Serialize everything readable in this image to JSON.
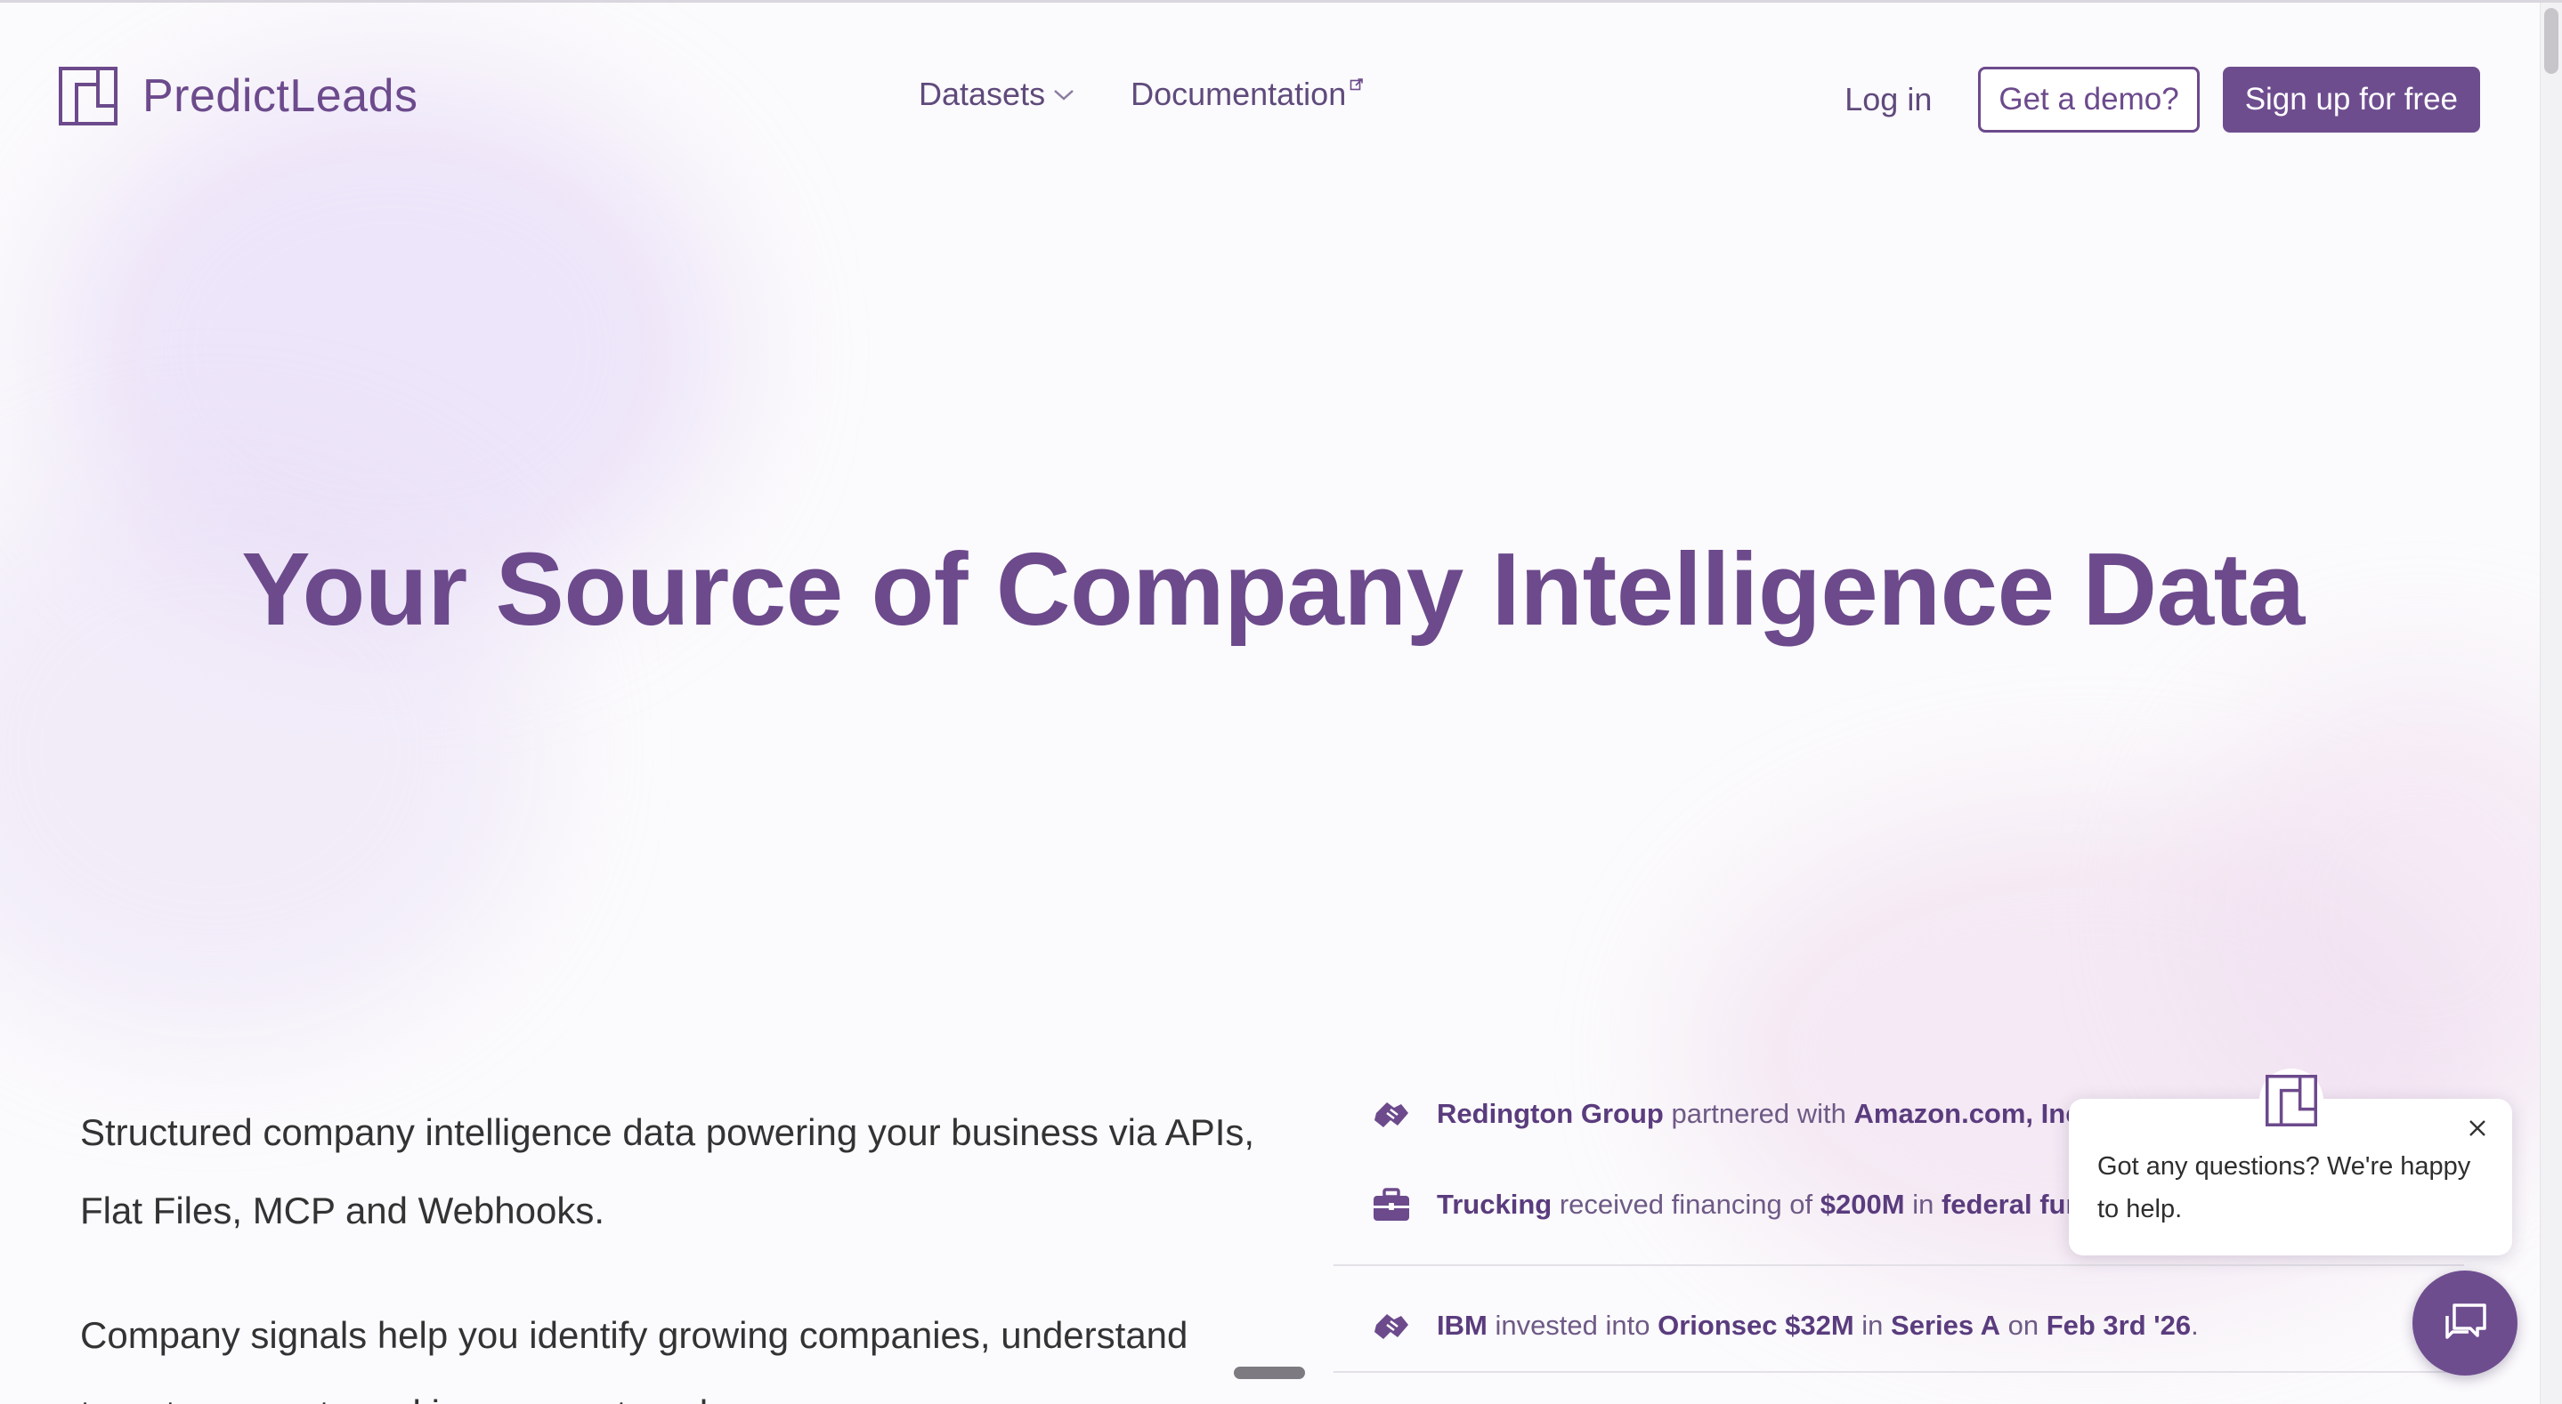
{
  "brand": {
    "name": "PredictLeads",
    "color": "#6c4a8c"
  },
  "nav": {
    "datasets": "Datasets",
    "documentation": "Documentation"
  },
  "header": {
    "login": "Log in",
    "demo": "Get a demo?",
    "signup": "Sign up for free"
  },
  "hero": {
    "title": "Your Source of Company Intelligence Data"
  },
  "copy": {
    "paragraph_1": "Structured company intelligence data powering your business via APIs, Flat Files, MCP and Webhooks.",
    "paragraph_2": "Company signals help you identify growing companies, understand target prospects and improve outreach."
  },
  "feed": {
    "items": [
      {
        "icon": "handshake-icon",
        "parts": [
          {
            "text": "Redington Group",
            "bold": true
          },
          {
            "text": " partnered with ",
            "bold": false
          },
          {
            "text": "Amazon.com, Inc.",
            "bold": true
          },
          {
            "text": " o",
            "bold": false
          }
        ]
      },
      {
        "icon": "briefcase-icon",
        "parts": [
          {
            "text": "Trucking",
            "bold": true
          },
          {
            "text": " received financing of ",
            "bold": false
          },
          {
            "text": "$200M",
            "bold": true
          },
          {
            "text": " in ",
            "bold": false
          },
          {
            "text": "federal fund",
            "bold": true
          }
        ]
      },
      {
        "icon": "handshake-icon",
        "parts": [
          {
            "text": "IBM",
            "bold": true
          },
          {
            "text": " invested into ",
            "bold": false
          },
          {
            "text": "Orionsec $32M",
            "bold": true
          },
          {
            "text": " in ",
            "bold": false
          },
          {
            "text": "Series A",
            "bold": true
          },
          {
            "text": " on ",
            "bold": false
          },
          {
            "text": "Feb 3rd '26",
            "bold": true
          },
          {
            "text": ".",
            "bold": false
          }
        ]
      }
    ]
  },
  "chat": {
    "message": "Got any questions? We're happy to help."
  }
}
